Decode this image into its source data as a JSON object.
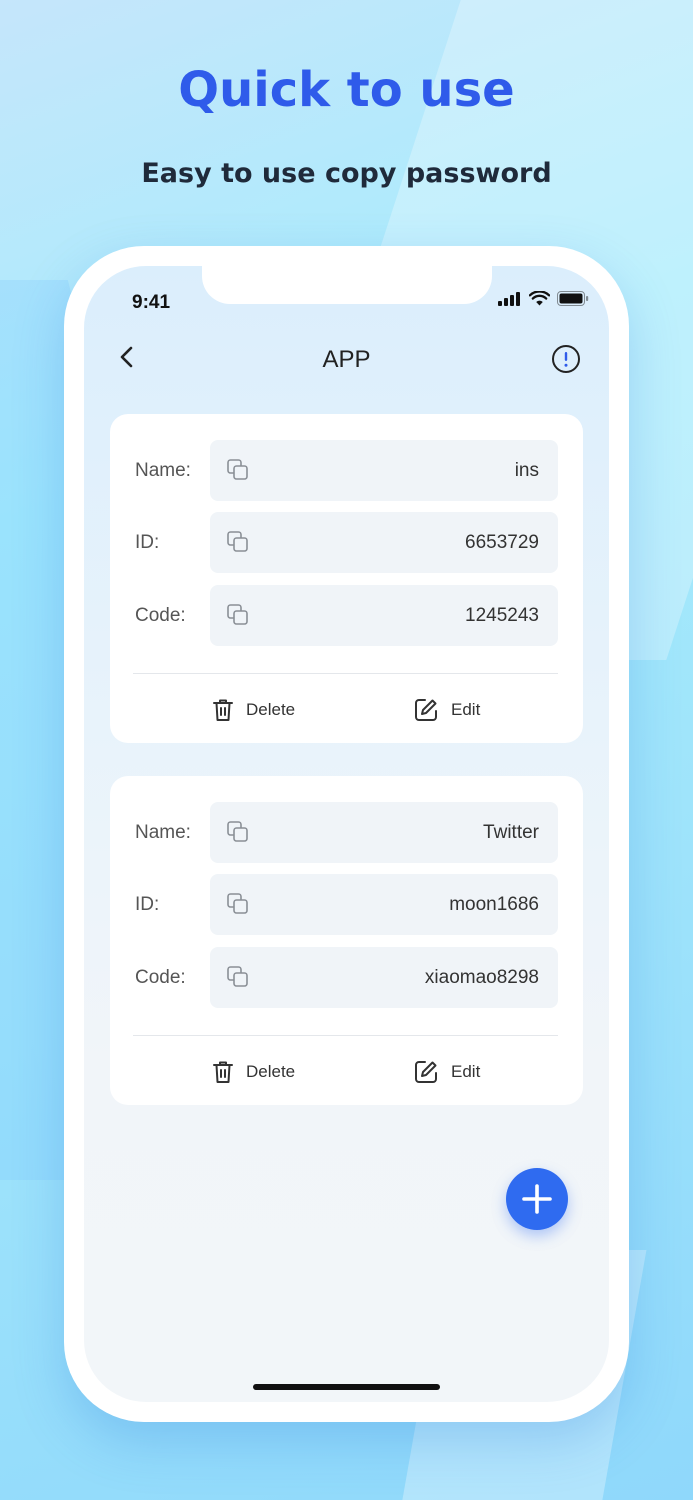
{
  "hero": {
    "title": "Quick to use",
    "subtitle": "Easy to use copy password"
  },
  "status_bar": {
    "time": "9:41",
    "icons": [
      "signal-icon",
      "wifi-icon",
      "battery-icon"
    ]
  },
  "nav": {
    "title": "APP",
    "back_icon": "chevron-left-icon",
    "info_icon": "info-icon"
  },
  "cards": [
    {
      "fields": [
        {
          "label": "Name:",
          "value": "ins"
        },
        {
          "label": "ID:",
          "value": "6653729"
        },
        {
          "label": "Code:",
          "value": "1245243"
        }
      ],
      "delete_label": "Delete",
      "edit_label": "Edit"
    },
    {
      "fields": [
        {
          "label": "Name:",
          "value": "Twitter"
        },
        {
          "label": "ID:",
          "value": "moon1686"
        },
        {
          "label": "Code:",
          "value": "xiaomao8298"
        }
      ],
      "delete_label": "Delete",
      "edit_label": "Edit"
    }
  ],
  "colors": {
    "accent": "#2f5bea",
    "fab": "#2f6bf0"
  }
}
